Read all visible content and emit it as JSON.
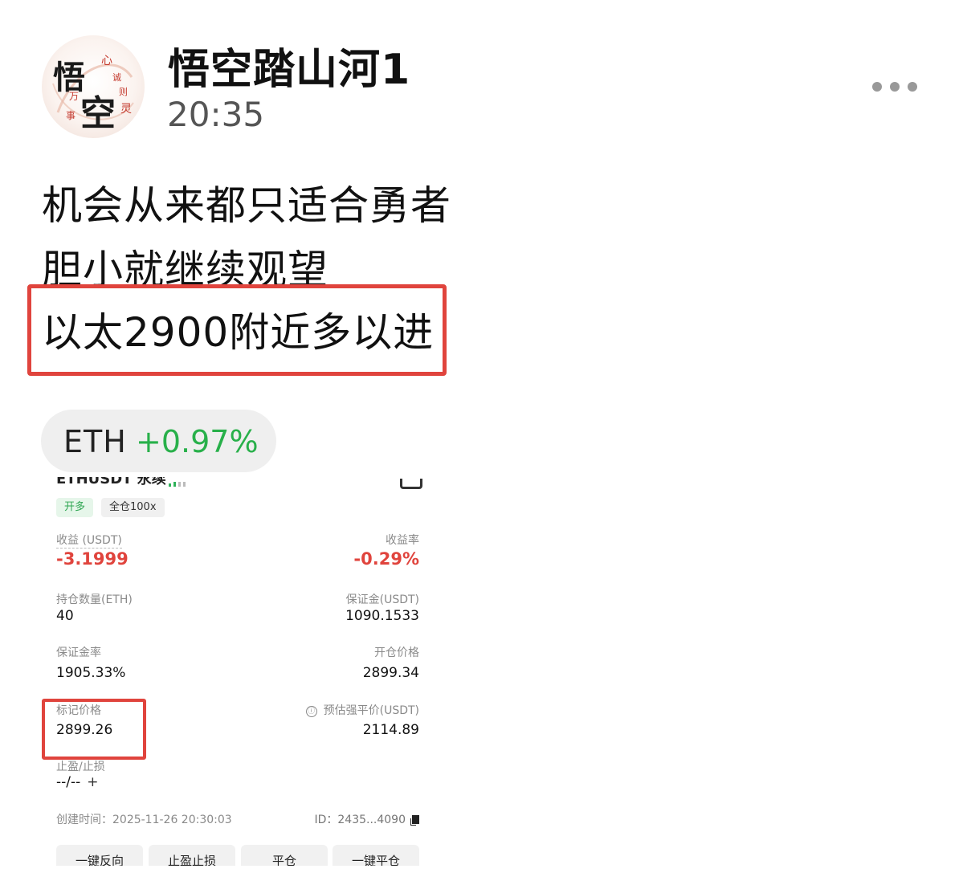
{
  "post": {
    "username": "悟空踏山河1",
    "time": "20:35",
    "avatar": {
      "big_chars": [
        "悟",
        "空"
      ],
      "small_chars": [
        "心",
        "诚",
        "则",
        "灵",
        "万",
        "事"
      ]
    },
    "lines": [
      "机会从来都只适合勇者",
      "胆小就继续观望",
      "以太2900附近多以进"
    ],
    "highlight_color": "#e0443d"
  },
  "ticker": {
    "symbol": "ETH",
    "change": "+0.97%",
    "change_color": "#28b04a"
  },
  "position": {
    "title": "ETHUSDT 永续",
    "badges": {
      "side": "开多",
      "margin_mode": "全仓100x"
    },
    "pnl": {
      "label": "收益 (USDT)",
      "value": "-3.1999"
    },
    "pnl_rate": {
      "label": "收益率",
      "value": "-0.29%"
    },
    "size": {
      "label": "持仓数量(ETH)",
      "value": "40"
    },
    "margin": {
      "label": "保证金(USDT)",
      "value": "1090.1533"
    },
    "margin_ratio": {
      "label": "保证金率",
      "value": "1905.33%"
    },
    "entry_price": {
      "label": "开仓价格",
      "value": "2899.34"
    },
    "mark_price": {
      "label": "标记价格",
      "value": "2899.26"
    },
    "liq_price": {
      "label": "预估强平价(USDT)",
      "value": "2114.89",
      "info_icon": "ⓘ"
    },
    "tp_sl": {
      "label": "止盈/止损",
      "value": "--/--",
      "add": "+"
    },
    "created": "创建时间：2025-11-26 20:30:03",
    "id": "ID：2435...4090",
    "actions": [
      "一键反向",
      "止盈止损",
      "平仓",
      "一键平仓"
    ],
    "loss_color": "#e0443d",
    "long_color": "#2fa653"
  }
}
